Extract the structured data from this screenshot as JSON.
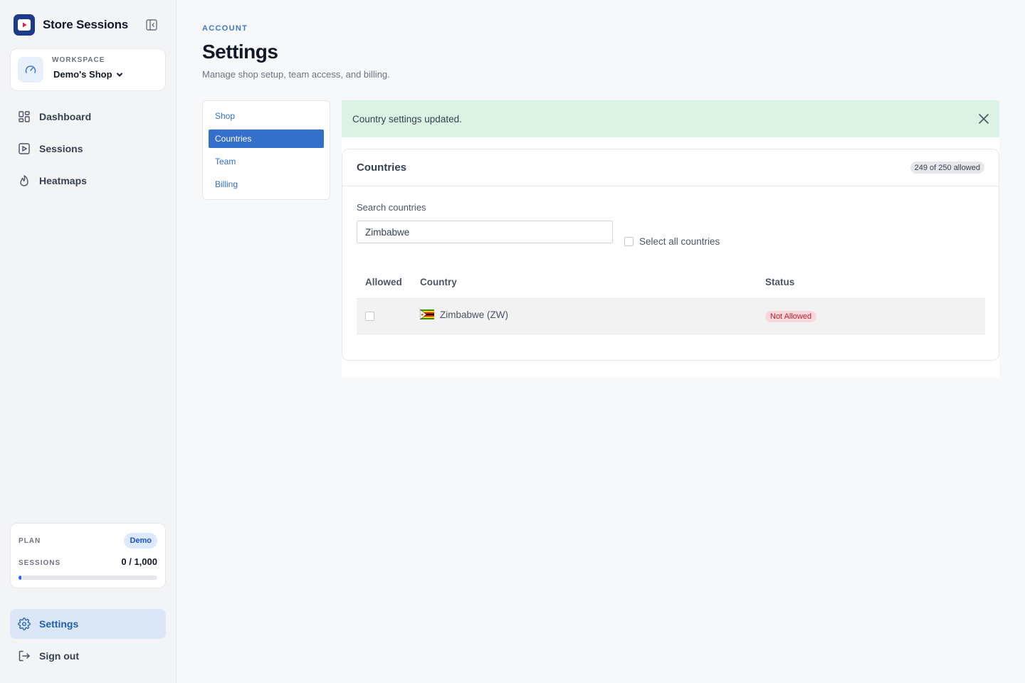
{
  "app": {
    "name": "Store Sessions"
  },
  "workspace": {
    "label": "WORKSPACE",
    "name": "Demo's Shop"
  },
  "nav": {
    "dashboard": "Dashboard",
    "sessions": "Sessions",
    "heatmaps": "Heatmaps",
    "settings": "Settings",
    "signout": "Sign out"
  },
  "plan": {
    "label": "PLAN",
    "badge": "Demo",
    "sessions_label": "SESSIONS",
    "sessions_value": "0 / 1,000",
    "usage_fraction": 0.0
  },
  "page": {
    "eyebrow": "ACCOUNT",
    "title": "Settings",
    "subtitle": "Manage shop setup, team access, and billing."
  },
  "subnav": {
    "shop": "Shop",
    "countries": "Countries",
    "team": "Team",
    "billing": "Billing"
  },
  "toast": {
    "message": "Country settings updated."
  },
  "countries": {
    "title": "Countries",
    "allowed_badge": "249 of 250 allowed",
    "search_label": "Search countries",
    "search_value": "Zimbabwe",
    "select_all_label": "Select all countries",
    "columns": {
      "allowed": "Allowed",
      "country": "Country",
      "status": "Status"
    },
    "rows": [
      {
        "country": "Zimbabwe (ZW)",
        "status": "Not Allowed",
        "allowed": false
      }
    ]
  },
  "colors": {
    "accent": "#356fcc",
    "toast_bg": "#dcf2e3",
    "not_allowed_bg": "#f8d7da",
    "not_allowed_text": "#b4232f"
  }
}
